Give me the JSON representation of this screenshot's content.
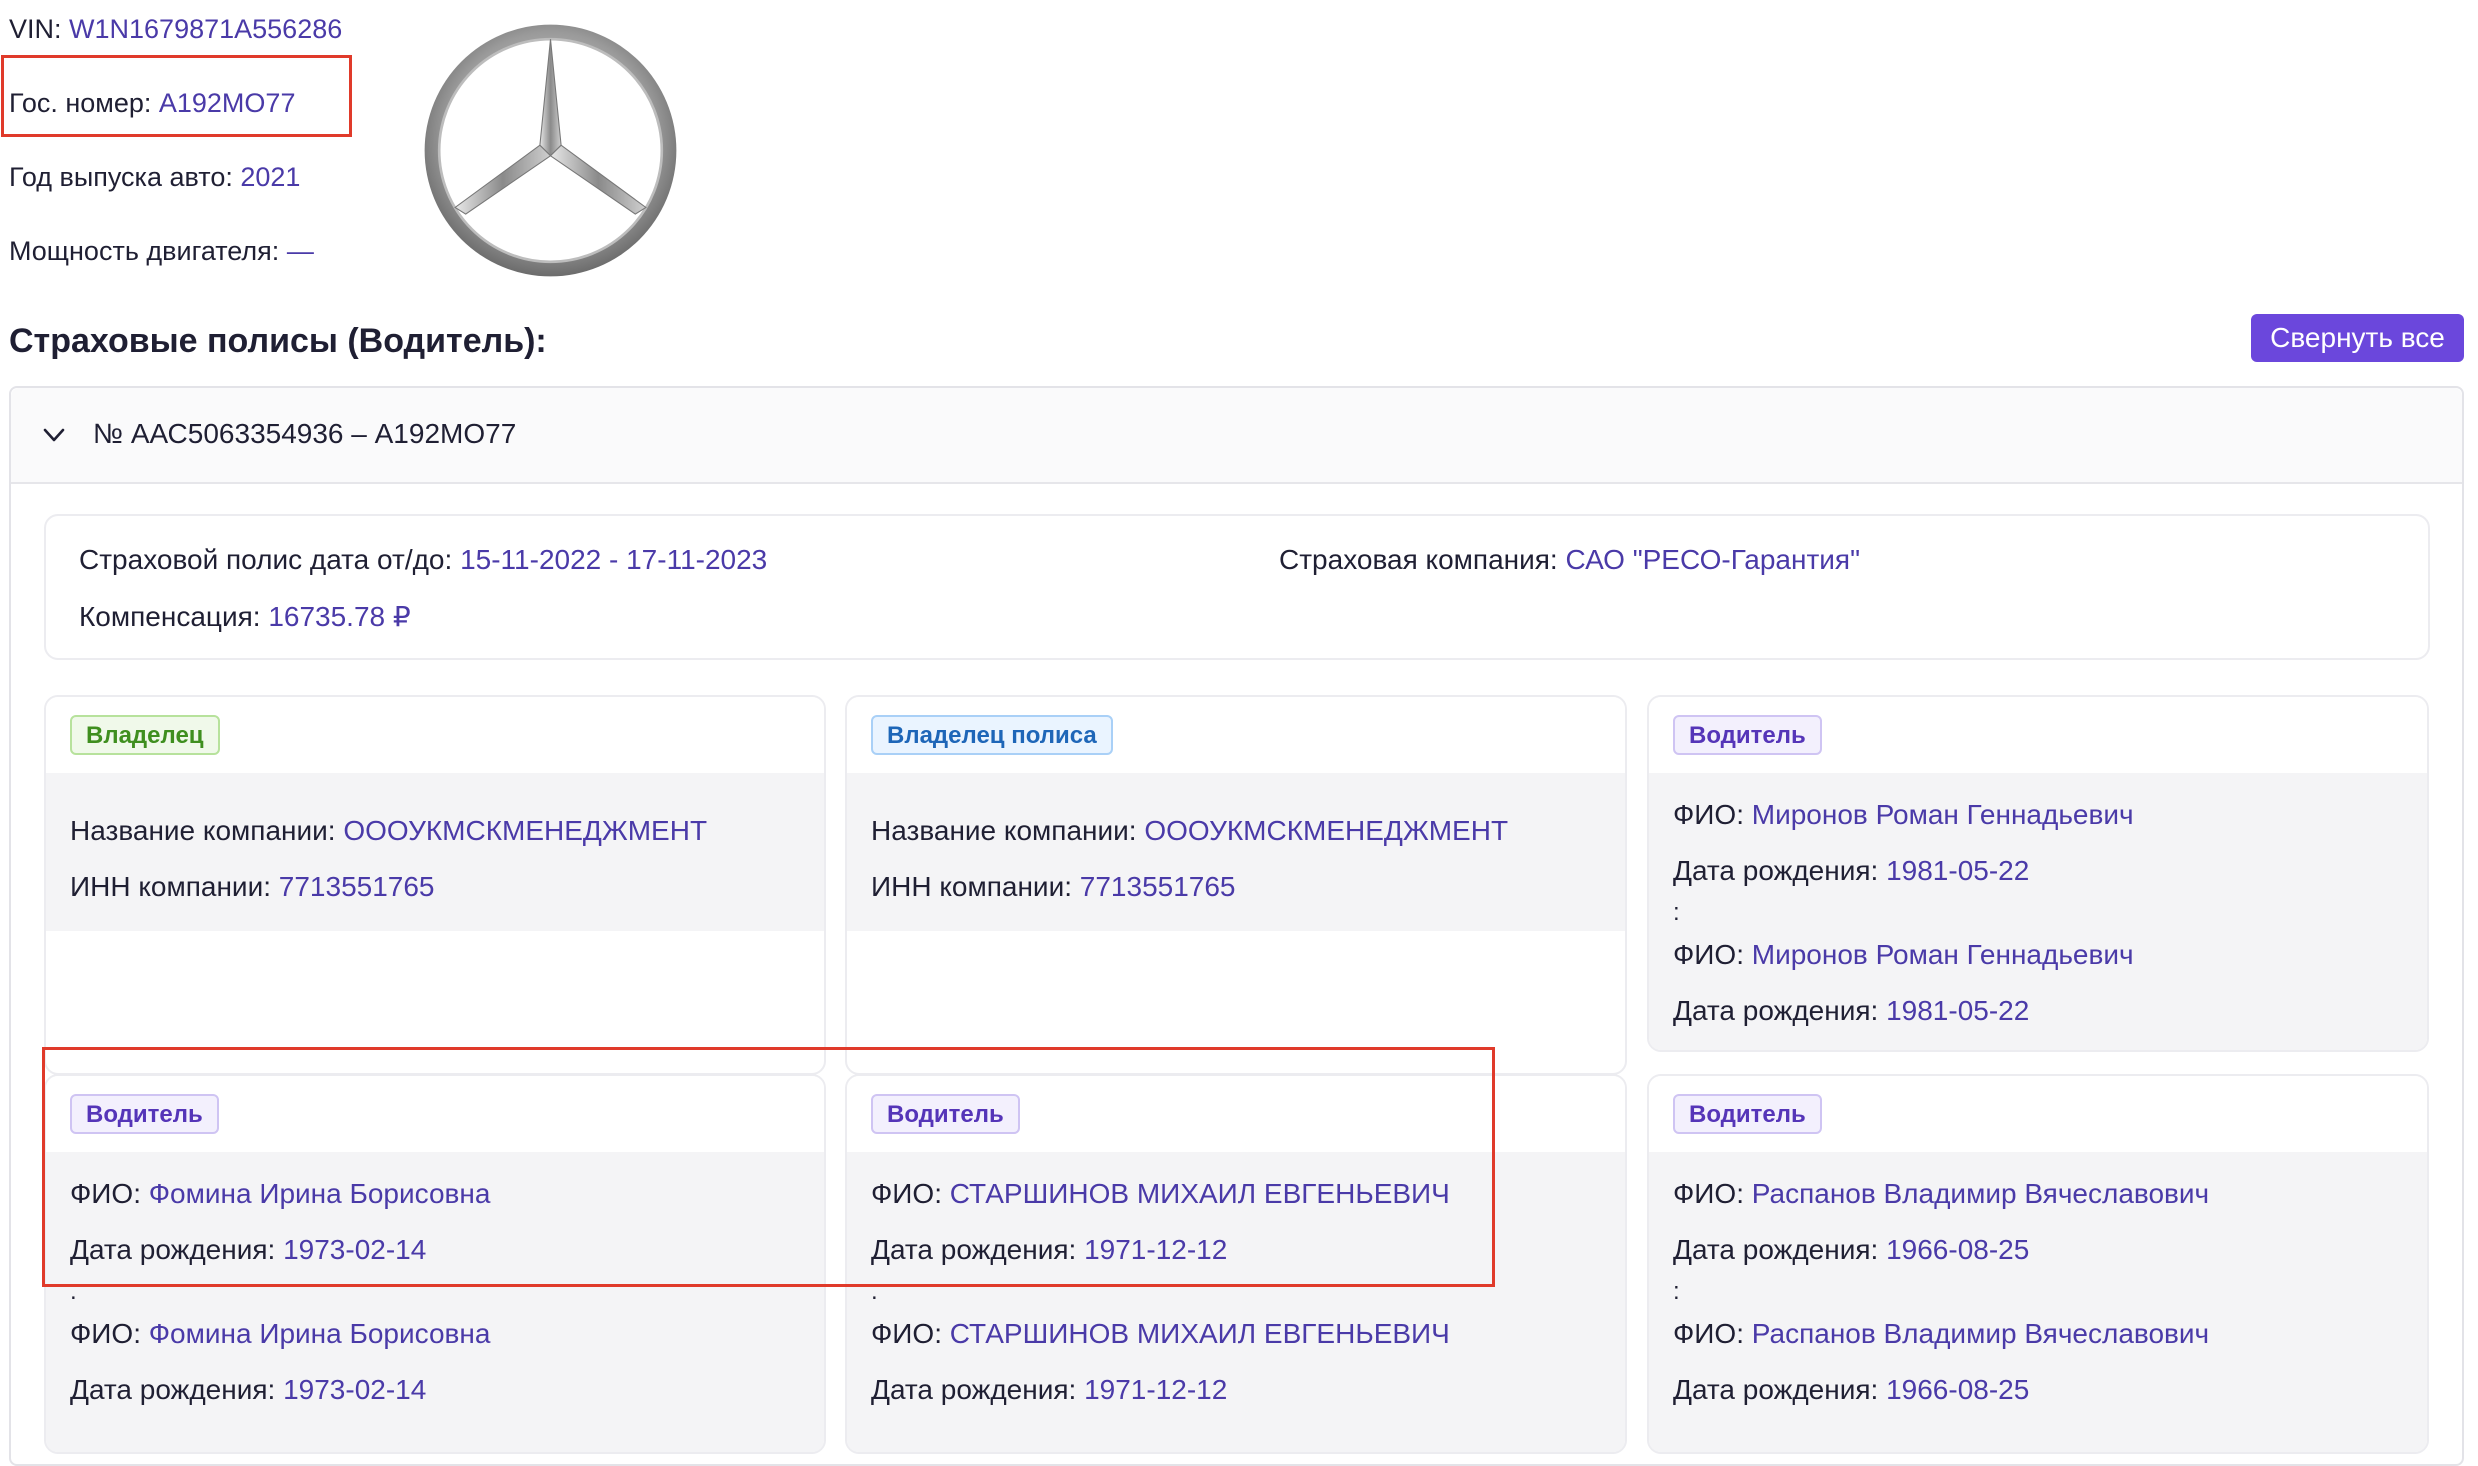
{
  "vehicle": {
    "vin_label": "VIN:",
    "vin": "W1N1679871A556286",
    "plate_label": "Гос. номер:",
    "plate": "А192МО77",
    "year_label": "Год выпуска авто:",
    "year": "2021",
    "power_label": "Мощность двигателя:",
    "power": "—",
    "brand_logo": "mercedes-benz-star-logo"
  },
  "section": {
    "title": "Страховые полисы (Водитель):",
    "collapse_all_label": "Свернуть все"
  },
  "policy": {
    "header": "№ ААС5063354936 – А192МО77",
    "date_label": "Страховой полис дата от/до:",
    "date_range": "15-11-2022 - 17-11-2023",
    "company_label": "Страховая компания:",
    "company": "САО \"РЕСО-Гарантия\"",
    "compensation_label": "Компенсация:",
    "compensation": "16735.78 ₽",
    "persons": [
      {
        "badge": "Владелец",
        "company_name_label": "Название компании:",
        "company_name": "ОООУКМСКМЕНЕДЖМЕНТ",
        "inn_label": "ИНН компании:",
        "inn": "7713551765"
      },
      {
        "badge": "Владелец полиса",
        "company_name_label": "Название компании:",
        "company_name": "ОООУКМСКМЕНЕДЖМЕНТ",
        "inn_label": "ИНН компании:",
        "inn": "7713551765"
      },
      {
        "badge": "Водитель",
        "fio_label": "ФИО:",
        "fio": "Миронов Роман Геннадьевич",
        "dob_label": "Дата рождения:",
        "dob": "1981-05-22",
        "sep": ":",
        "fio2": "Миронов Роман Геннадьевич",
        "dob2": "1981-05-22"
      },
      {
        "badge": "Водитель",
        "fio_label": "ФИО:",
        "fio": "Фомина Ирина Борисовна",
        "dob_label": "Дата рождения:",
        "dob": "1973-02-14",
        "sep": ".",
        "fio2": "Фомина Ирина Борисовна",
        "dob2": "1973-02-14"
      },
      {
        "badge": "Водитель",
        "fio_label": "ФИО:",
        "fio": "СТАРШИНОВ МИХАИЛ ЕВГЕНЬЕВИЧ",
        "dob_label": "Дата рождения:",
        "dob": "1971-12-12",
        "sep": ".",
        "fio2": "СТАРШИНОВ МИХАИЛ ЕВГЕНЬЕВИЧ",
        "dob2": "1971-12-12"
      },
      {
        "badge": "Водитель",
        "fio_label": "ФИО:",
        "fio": "Распанов Владимир Вячеславович",
        "dob_label": "Дата рождения:",
        "dob": "1966-08-25",
        "sep": ":",
        "fio2": "Распанов Владимир Вячеславович",
        "dob2": "1966-08-25"
      }
    ]
  },
  "colors": {
    "accent": "#6b47dc",
    "value_text": "#4a3aa8",
    "highlight_border": "#e03a2a"
  }
}
